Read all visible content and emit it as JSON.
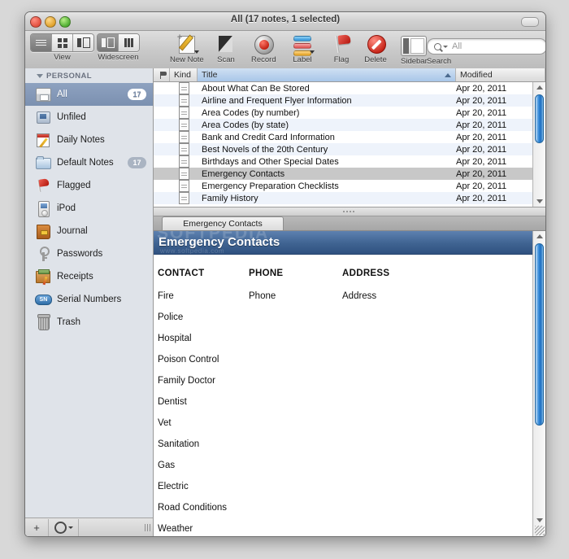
{
  "window": {
    "title": "All (17 notes, 1 selected)"
  },
  "toolbar": {
    "view_label": "View",
    "widescreen_label": "Widescreen",
    "new_note_label": "New Note",
    "scan_label": "Scan",
    "record_label": "Record",
    "label_label": "Label",
    "flag_label": "Flag",
    "delete_label": "Delete",
    "sidebar_label": "Sidebar",
    "search_label": "Search",
    "search_value": "",
    "search_placeholder": "All"
  },
  "sidebar": {
    "section_title": "PERSONAL",
    "items": [
      {
        "label": "All",
        "icon": "file-box-icon",
        "badge": "17",
        "selected": true
      },
      {
        "label": "Unfiled",
        "icon": "inbox-icon",
        "badge": "",
        "selected": false
      },
      {
        "label": "Daily Notes",
        "icon": "notepad-pencil-icon",
        "badge": "",
        "selected": false
      },
      {
        "label": "Default Notes",
        "icon": "folder-icon",
        "badge": "17",
        "selected": false
      },
      {
        "label": "Flagged",
        "icon": "flag-icon",
        "badge": "",
        "selected": false
      },
      {
        "label": "iPod",
        "icon": "ipod-icon",
        "badge": "",
        "selected": false
      },
      {
        "label": "Journal",
        "icon": "journal-icon",
        "badge": "",
        "selected": false
      },
      {
        "label": "Passwords",
        "icon": "keys-icon",
        "badge": "",
        "selected": false
      },
      {
        "label": "Receipts",
        "icon": "receipt-icon",
        "badge": "",
        "selected": false
      },
      {
        "label": "Serial Numbers",
        "icon": "serial-number-icon",
        "badge": "",
        "selected": false
      },
      {
        "label": "Trash",
        "icon": "trash-icon",
        "badge": "",
        "selected": false
      }
    ],
    "footer": {
      "add_label": "+",
      "action_label": "gear-icon"
    }
  },
  "note_list": {
    "columns": {
      "flag": "",
      "kind": "Kind",
      "title": "Title",
      "modified": "Modified"
    },
    "sorted_column": "Title",
    "rows": [
      {
        "title": "About What Can Be Stored",
        "modified": "Apr 20, 2011",
        "selected": false
      },
      {
        "title": "Airline and Frequent Flyer Information",
        "modified": "Apr 20, 2011",
        "selected": false
      },
      {
        "title": "Area Codes (by number)",
        "modified": "Apr 20, 2011",
        "selected": false
      },
      {
        "title": "Area Codes (by state)",
        "modified": "Apr 20, 2011",
        "selected": false
      },
      {
        "title": "Bank and Credit Card Information",
        "modified": "Apr 20, 2011",
        "selected": false
      },
      {
        "title": "Best Novels of the 20th Century",
        "modified": "Apr 20, 2011",
        "selected": false
      },
      {
        "title": "Birthdays and Other Special Dates",
        "modified": "Apr 20, 2011",
        "selected": false
      },
      {
        "title": "Emergency Contacts",
        "modified": "Apr 20, 2011",
        "selected": true
      },
      {
        "title": "Emergency Preparation Checklists",
        "modified": "Apr 20, 2011",
        "selected": false
      },
      {
        "title": "Family History",
        "modified": "Apr 20, 2011",
        "selected": false
      }
    ]
  },
  "tab_bar": {
    "tabs": [
      {
        "label": "Emergency Contacts",
        "active": true
      }
    ]
  },
  "note": {
    "title": "Emergency Contacts",
    "watermark_primary": "SOFTPEDIA",
    "watermark_secondary": "www.softpedia.com",
    "columns": [
      "CONTACT",
      "PHONE",
      "ADDRESS"
    ],
    "rows": [
      {
        "contact": "Fire",
        "phone": "Phone",
        "address": "Address"
      },
      {
        "contact": "Police",
        "phone": "",
        "address": ""
      },
      {
        "contact": "Hospital",
        "phone": "",
        "address": ""
      },
      {
        "contact": "Poison Control",
        "phone": "",
        "address": ""
      },
      {
        "contact": "Family Doctor",
        "phone": "",
        "address": ""
      },
      {
        "contact": "Dentist",
        "phone": "",
        "address": ""
      },
      {
        "contact": "Vet",
        "phone": "",
        "address": ""
      },
      {
        "contact": "Sanitation",
        "phone": "",
        "address": ""
      },
      {
        "contact": "Gas",
        "phone": "",
        "address": ""
      },
      {
        "contact": "Electric",
        "phone": "",
        "address": ""
      },
      {
        "contact": "Road Conditions",
        "phone": "",
        "address": ""
      },
      {
        "contact": "Weather",
        "phone": "",
        "address": ""
      }
    ]
  },
  "colors": {
    "selection_blue": "#7b90b0",
    "banner_blue": "#3f6391",
    "scrollbar_blue": "#2f86d8",
    "row_stripe": "#eef3fb"
  }
}
